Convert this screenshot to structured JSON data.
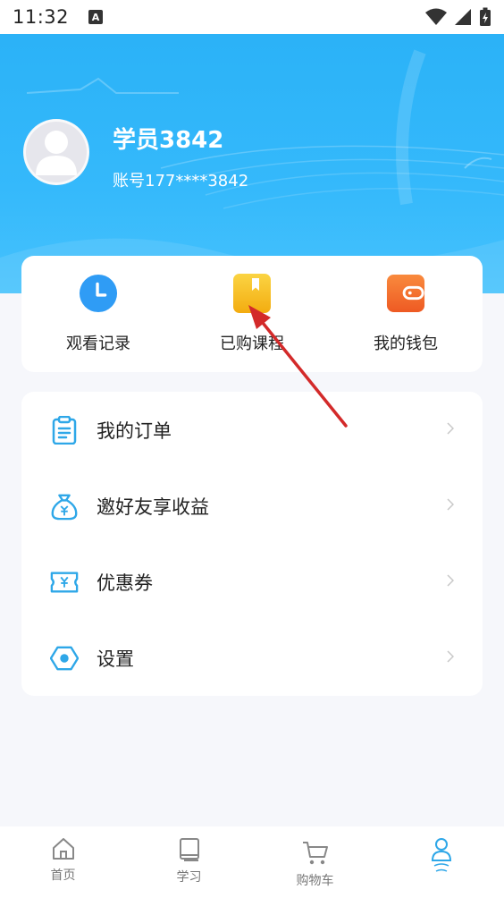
{
  "status_bar": {
    "time": "11:32",
    "notification_letter": "A"
  },
  "profile": {
    "name": "学员3842",
    "account": "账号177****3842"
  },
  "quick_actions": [
    {
      "label": "观看记录",
      "icon": "clock-icon",
      "color": "#2f9cf5"
    },
    {
      "label": "已购课程",
      "icon": "bookmark-book-icon",
      "color": "#f8c21c"
    },
    {
      "label": "我的钱包",
      "icon": "wallet-icon",
      "color": "#f26a2d"
    }
  ],
  "menu": [
    {
      "label": "我的订单",
      "icon": "clipboard-icon"
    },
    {
      "label": "邀好友享收益",
      "icon": "money-bag-icon"
    },
    {
      "label": "优惠券",
      "icon": "coupon-icon"
    },
    {
      "label": "设置",
      "icon": "settings-hexagon-icon"
    }
  ],
  "bottom_nav": [
    {
      "label": "首页",
      "icon": "home-icon"
    },
    {
      "label": "学习",
      "icon": "book-icon"
    },
    {
      "label": "购物车",
      "icon": "cart-icon"
    },
    {
      "label": "",
      "icon": "profile-icon",
      "active": true
    }
  ],
  "colors": {
    "header": "#2bb2f7",
    "accent": "#2f9cf5",
    "annotation_arrow": "#d32a2a"
  }
}
